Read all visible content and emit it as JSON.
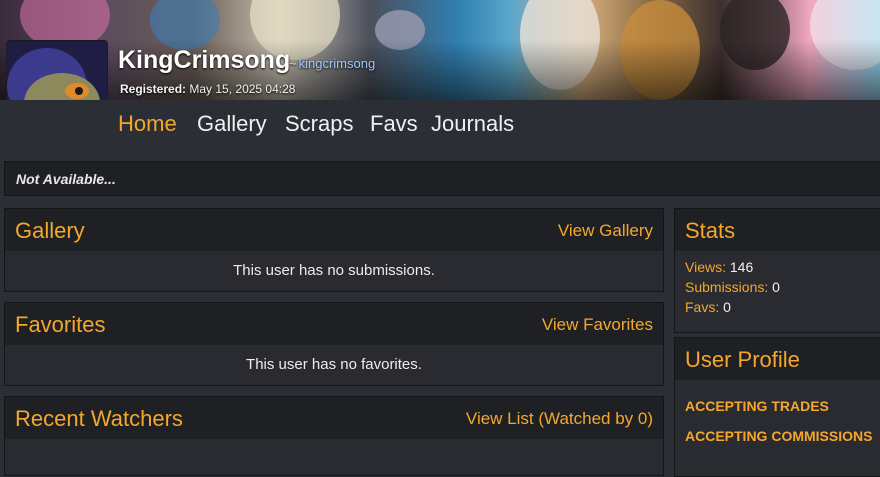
{
  "profile": {
    "display_name": "KingCrimsong",
    "handle_prefix": "~",
    "handle": "kingcrimsong",
    "registered_label": "Registered:",
    "registered_value": "May 15, 2025 04:28"
  },
  "nav": {
    "items": [
      "Home",
      "Gallery",
      "Scraps",
      "Favs",
      "Journals"
    ],
    "active": "Home"
  },
  "status": {
    "text": "Not Available..."
  },
  "gallery": {
    "title": "Gallery",
    "link": "View Gallery",
    "empty": "This user has no submissions."
  },
  "favorites": {
    "title": "Favorites",
    "link": "View Favorites",
    "empty": "This user has no favorites."
  },
  "watchers": {
    "title": "Recent Watchers",
    "link": "View List (Watched by 0)"
  },
  "stats": {
    "title": "Stats",
    "views_label": "Views:",
    "views": "146",
    "submissions_label": "Submissions:",
    "submissions": "0",
    "favs_label": "Favs:",
    "favs": "0"
  },
  "user_profile": {
    "title": "User Profile",
    "tags": [
      "ACCEPTING TRADES",
      "ACCEPTING COMMISSIONS"
    ]
  },
  "colors": {
    "accent": "#f4a72c",
    "panel": "#1f2024",
    "page": "#2b2e34",
    "handle": "#9ec8f5"
  }
}
